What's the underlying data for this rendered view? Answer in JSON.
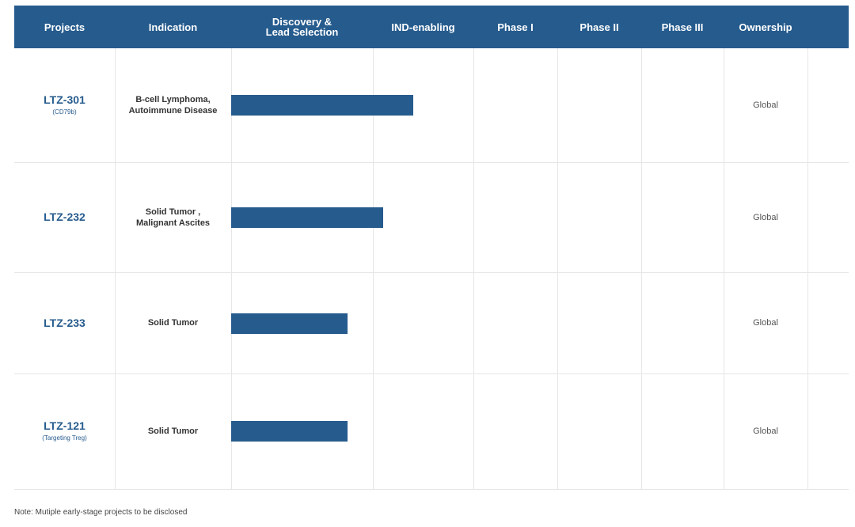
{
  "table": {
    "headers": [
      "Projects",
      "Indication",
      "Discovery &\nLead Selection",
      "IND-enabling",
      "Phase I",
      "Phase II",
      "Phase III",
      "Ownership"
    ],
    "colors": {
      "header_bg": "#265b8d",
      "bar": "#265b8d",
      "project_text": "#265b8d"
    },
    "rows": [
      {
        "project": "LTZ-301",
        "sub": "(CD79b)",
        "indication": "B-cell Lymphoma,\nAutoimmune Disease",
        "ownership": "Global",
        "progress_stages": 1.4
      },
      {
        "project": "LTZ-232",
        "sub": "",
        "indication": "Solid Tumor ,\nMalignant Ascites",
        "ownership": "Global",
        "progress_stages": 1.1
      },
      {
        "project": "LTZ-233",
        "sub": "",
        "indication": "Solid Tumor",
        "ownership": "Global",
        "progress_stages": 0.82
      },
      {
        "project": "LTZ-121",
        "sub": "(Targeting Treg)",
        "indication": "Solid Tumor",
        "ownership": "Global",
        "progress_stages": 0.82
      }
    ]
  },
  "note": "Note: Mutiple early-stage projects to be disclosed"
}
